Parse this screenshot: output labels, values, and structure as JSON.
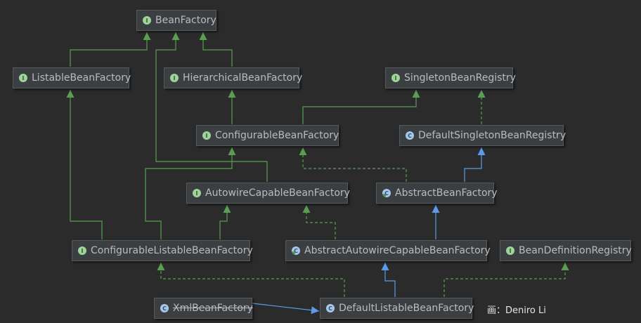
{
  "nodes": {
    "BeanFactory": {
      "label": "BeanFactory",
      "kind": "interface",
      "badge": "I"
    },
    "ListableBeanFactory": {
      "label": "ListableBeanFactory",
      "kind": "interface",
      "badge": "I"
    },
    "HierarchicalBeanFactory": {
      "label": "HierarchicalBeanFactory",
      "kind": "interface",
      "badge": "I"
    },
    "SingletonBeanRegistry": {
      "label": "SingletonBeanRegistry",
      "kind": "interface",
      "badge": "I"
    },
    "ConfigurableBeanFactory": {
      "label": "ConfigurableBeanFactory",
      "kind": "interface",
      "badge": "I"
    },
    "DefaultSingletonBeanRegistry": {
      "label": "DefaultSingletonBeanRegistry",
      "kind": "class",
      "badge": "C"
    },
    "AutowireCapableBeanFactory": {
      "label": "AutowireCapableBeanFactory",
      "kind": "interface",
      "badge": "I"
    },
    "AbstractBeanFactory": {
      "label": "AbstractBeanFactory",
      "kind": "abstract-class",
      "badge": "C"
    },
    "ConfigurableListableBeanFactory": {
      "label": "ConfigurableListableBeanFactory",
      "kind": "interface",
      "badge": "I"
    },
    "AbstractAutowireCapableBeanFactory": {
      "label": "AbstractAutowireCapableBeanFactory",
      "kind": "abstract-class",
      "badge": "C"
    },
    "BeanDefinitionRegistry": {
      "label": "BeanDefinitionRegistry",
      "kind": "interface",
      "badge": "I"
    },
    "XmlBeanFactory": {
      "label": "XmlBeanFactory",
      "kind": "class",
      "badge": "C",
      "deprecated": true
    },
    "DefaultListableBeanFactory": {
      "label": "DefaultListableBeanFactory",
      "kind": "class",
      "badge": "C"
    }
  },
  "edges": [
    {
      "from": "ListableBeanFactory",
      "to": "BeanFactory",
      "type": "extends"
    },
    {
      "from": "HierarchicalBeanFactory",
      "to": "BeanFactory",
      "type": "extends"
    },
    {
      "from": "AutowireCapableBeanFactory",
      "to": "BeanFactory",
      "type": "extends"
    },
    {
      "from": "ConfigurableBeanFactory",
      "to": "HierarchicalBeanFactory",
      "type": "extends"
    },
    {
      "from": "ConfigurableBeanFactory",
      "to": "SingletonBeanRegistry",
      "type": "extends"
    },
    {
      "from": "DefaultSingletonBeanRegistry",
      "to": "SingletonBeanRegistry",
      "type": "implements"
    },
    {
      "from": "AbstractBeanFactory",
      "to": "DefaultSingletonBeanRegistry",
      "type": "class-extends"
    },
    {
      "from": "AbstractBeanFactory",
      "to": "ConfigurableBeanFactory",
      "type": "implements"
    },
    {
      "from": "ConfigurableListableBeanFactory",
      "to": "ListableBeanFactory",
      "type": "extends"
    },
    {
      "from": "ConfigurableListableBeanFactory",
      "to": "ConfigurableBeanFactory",
      "type": "extends"
    },
    {
      "from": "ConfigurableListableBeanFactory",
      "to": "AutowireCapableBeanFactory",
      "type": "extends"
    },
    {
      "from": "AbstractAutowireCapableBeanFactory",
      "to": "AbstractBeanFactory",
      "type": "class-extends"
    },
    {
      "from": "AbstractAutowireCapableBeanFactory",
      "to": "AutowireCapableBeanFactory",
      "type": "implements"
    },
    {
      "from": "DefaultListableBeanFactory",
      "to": "AbstractAutowireCapableBeanFactory",
      "type": "class-extends"
    },
    {
      "from": "DefaultListableBeanFactory",
      "to": "ConfigurableListableBeanFactory",
      "type": "implements"
    },
    {
      "from": "DefaultListableBeanFactory",
      "to": "BeanDefinitionRegistry",
      "type": "implements"
    },
    {
      "from": "XmlBeanFactory",
      "to": "DefaultListableBeanFactory",
      "type": "class-extends"
    }
  ],
  "colors": {
    "background": "#2b2b2b",
    "extends": "#5a9e52",
    "implements": "#5a9e52",
    "class_extends": "#5b9bea",
    "text": "#b9bcbe"
  },
  "credit": "画：Deniro Li"
}
